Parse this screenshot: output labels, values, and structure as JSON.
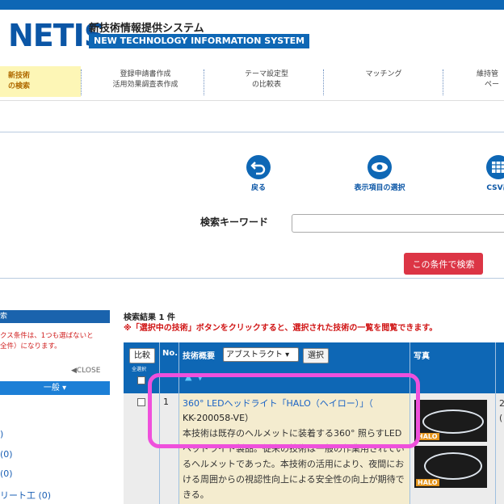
{
  "header": {
    "logo": "NETIS",
    "subtitle_jp": "新技術情報提供システム",
    "subtitle_en": "NEW TECHNOLOGY INFORMATION SYSTEM"
  },
  "nav": [
    {
      "line1": "新技術",
      "line2": "の検索"
    },
    {
      "line1": "登録申請書作成",
      "line2": "活用効果調査表作成"
    },
    {
      "line1": "テーマ設定型",
      "line2": "の比較表"
    },
    {
      "line1": "マッチング",
      "line2": ""
    },
    {
      "line1": "維持管",
      "line2": "ペー"
    }
  ],
  "toolbar": {
    "back_label": "戻る",
    "columns_label": "表示項目の選択",
    "csv_label": "CSV出"
  },
  "search": {
    "keyword_label": "検索キーワード",
    "keyword_value": "",
    "submit_label": "この条件で検索"
  },
  "sidebar": {
    "head": "索",
    "note": "クス条件は、1つも選ばないと\n全件）になります。",
    "close_label": "◀CLOSE",
    "general_label": "一般 ▾",
    "counts": [
      ")",
      "(0)",
      "(0)",
      "リート工 (0)"
    ]
  },
  "results": {
    "count_text": "検索結果 1 件",
    "note": "※「選択中の技術」ボタンをクリックすると、選択された技術の一覧を閲覧できます。",
    "compare_label": "比較",
    "select_all_label": "全選択",
    "no_label": "No.",
    "summary_label": "技術概要",
    "abstract_option": "アブストラクト ▾",
    "select_label": "選択",
    "photo_label": "写真",
    "extra_col_label": "",
    "sort_arrows": "▲▼",
    "row": {
      "no": "1",
      "title": "360° LEDヘッドライト「HALO（ヘイロー）」（",
      "id": "KK-200058-VE）",
      "desc": "本技術は既存のヘルメットに装着する360° 照らすLEDヘッドライト製品。従来の技術は一般の作業用されているヘルメットであった。本技術の活用により、夜間における周囲からの視認性向上による安全性の向上が期待できる。",
      "right_col": "2\n(",
      "photo_tag_1": "HALO",
      "photo_tag_2": "HALO"
    }
  },
  "colors": {
    "brand_blue": "#0e67b5",
    "danger_red": "#dc3545",
    "highlight_magenta": "#ef50dc"
  }
}
